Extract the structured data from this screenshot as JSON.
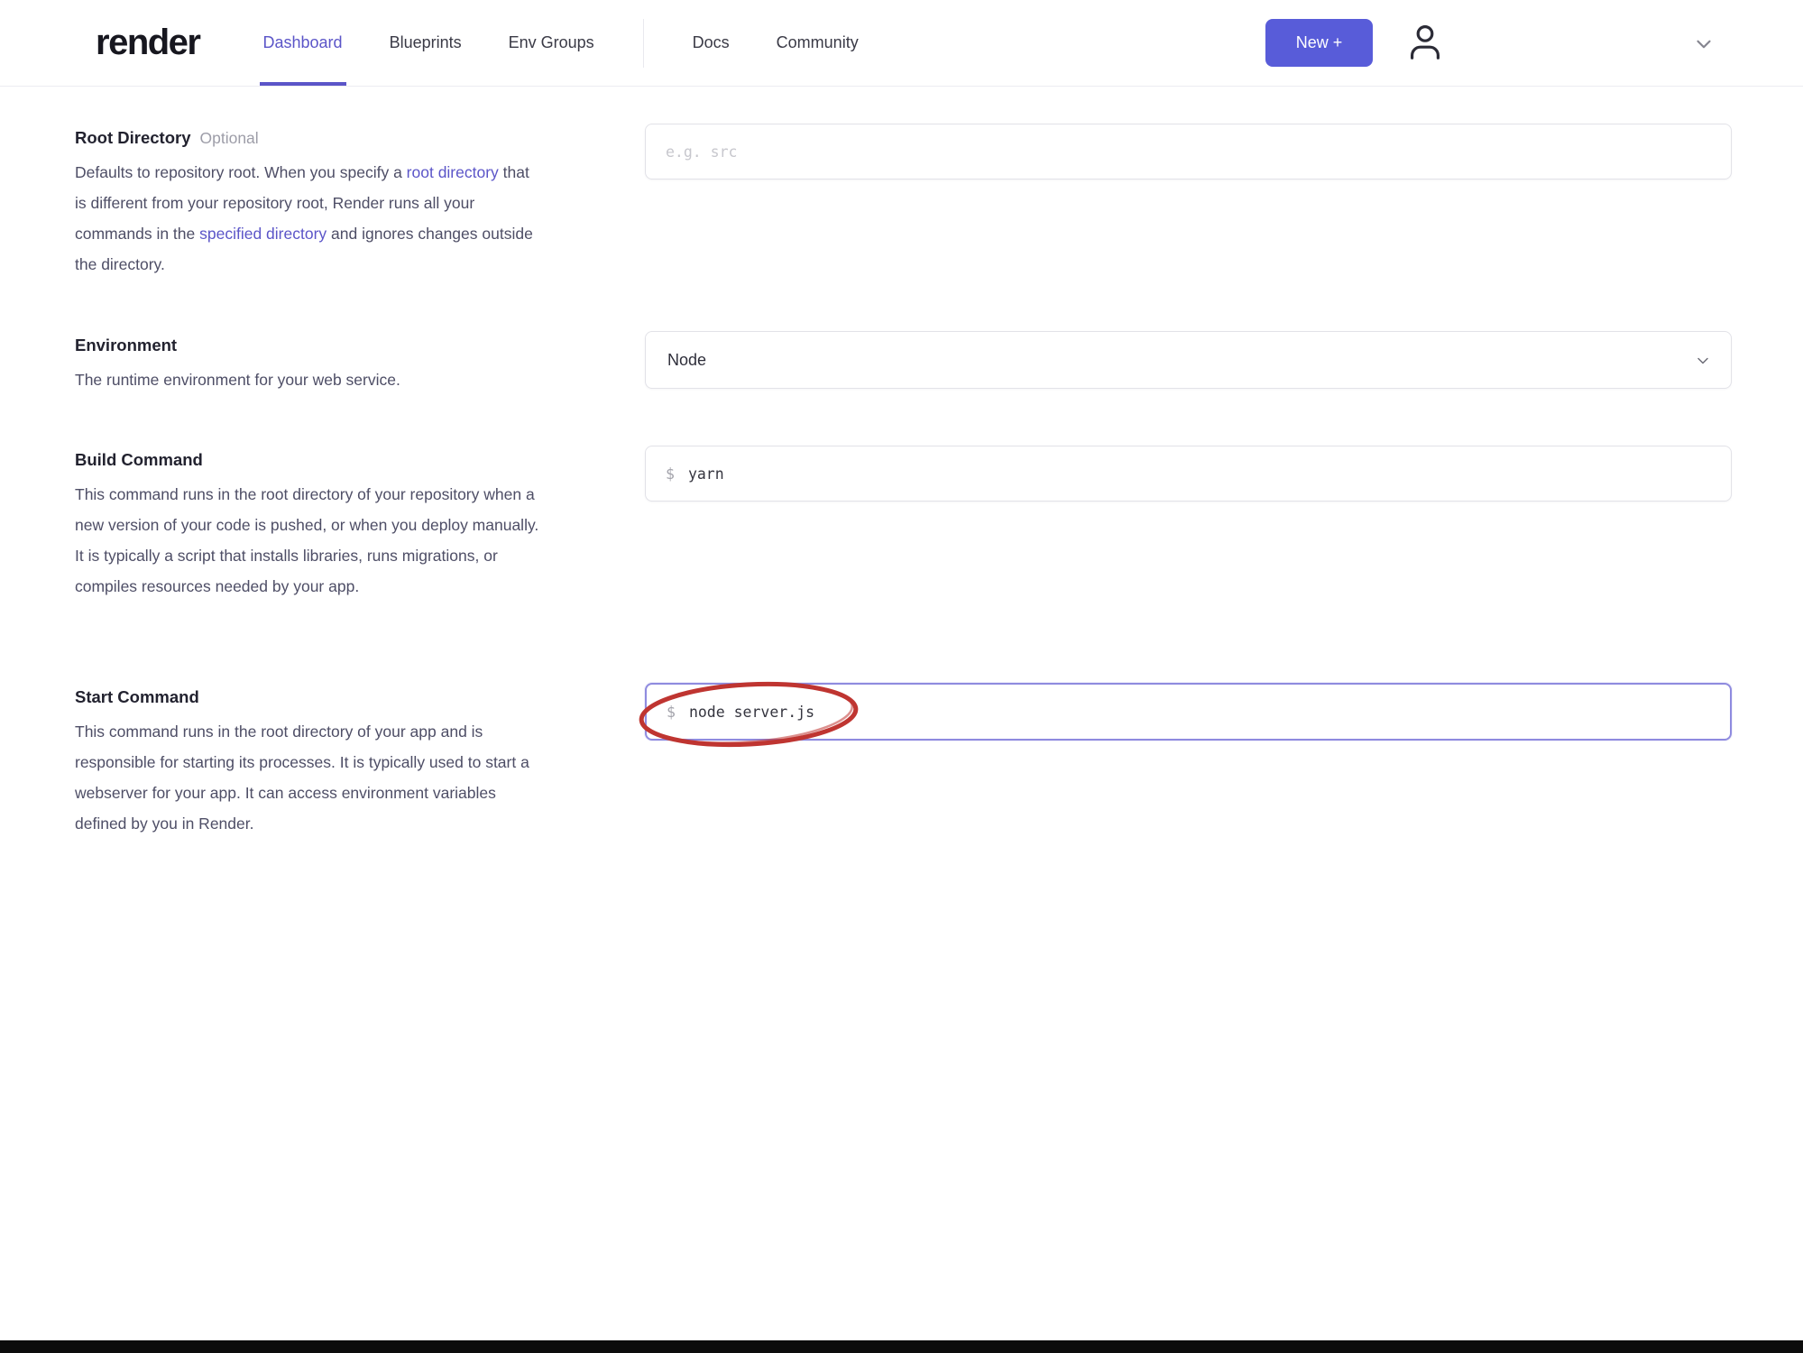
{
  "header": {
    "logo_text": "render",
    "nav_primary": [
      {
        "label": "Dashboard",
        "active": true
      },
      {
        "label": "Blueprints",
        "active": false
      },
      {
        "label": "Env Groups",
        "active": false
      }
    ],
    "nav_secondary": [
      {
        "label": "Docs"
      },
      {
        "label": "Community"
      }
    ],
    "new_button_label": "New +",
    "account_icon": "person-icon",
    "account_menu_icon": "chevron-down-icon"
  },
  "form": {
    "root_directory": {
      "label": "Root Directory",
      "tag": "Optional",
      "desc_part1": "Defaults to repository root. When you specify a ",
      "desc_link1": "root directory",
      "desc_part2": " that is different from your repository root, Render runs all your commands in the ",
      "desc_link2": "specified directory",
      "desc_part3": " and ignores changes outside the directory.",
      "input_value": "",
      "input_placeholder": "e.g. src"
    },
    "environment": {
      "label": "Environment",
      "description": "The runtime environment for your web service.",
      "selected_value": "Node",
      "dropdown_icon": "chevron-down-icon"
    },
    "build_command": {
      "label": "Build Command",
      "description": "This command runs in the root directory of your repository when a new version of your code is pushed, or when you deploy manually. It is typically a script that installs libraries, runs migrations, or compiles resources needed by your app.",
      "prompt_prefix": "$",
      "input_value": "yarn"
    },
    "start_command": {
      "label": "Start Command",
      "description": "This command runs in the root directory of your app and is responsible for starting its processes. It is typically used to start a webserver for your app. It can access environment variables defined by you in Render.",
      "prompt_prefix": "$",
      "input_value": "node server.js",
      "focused": true
    }
  },
  "annotation": {
    "shape": "red-ellipse",
    "target": "start-command-value",
    "color": "#bf3531"
  },
  "colors": {
    "accent_purple": "#5b55c8",
    "button_purple": "#585cd9",
    "focus_border": "#8f8bdf",
    "annotation_red": "#bf3531",
    "bottom_bar": "#0c0c0c"
  }
}
